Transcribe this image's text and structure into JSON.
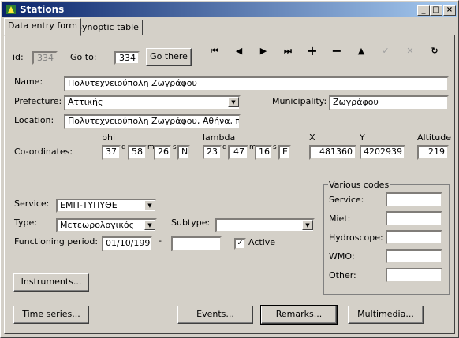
{
  "window": {
    "title": "Stations"
  },
  "tabs": [
    {
      "label": "Data entry form"
    },
    {
      "label": "Synoptic table"
    }
  ],
  "nav": {
    "id_label": "id:",
    "id_value": "334",
    "goto_label": "Go to:",
    "goto_value": "334",
    "goto_button": "Go there",
    "buttons": [
      "first",
      "previous",
      "next",
      "last",
      "add",
      "delete",
      "edit",
      "confirm",
      "cancel",
      "refresh"
    ]
  },
  "form": {
    "name_label": "Name:",
    "name_value": "Πολυτεχνειούπολη Ζωγράφου",
    "prefecture_label": "Prefecture:",
    "prefecture_value": "Αττικής",
    "municipality_label": "Municipality:",
    "municipality_value": "Ζωγράφου",
    "location_label": "Location:",
    "location_value": "Πολυτεχνειούπολη Ζωγράφου, Αθήνα, περίπ",
    "coords_label": "Co-ordinates:",
    "phi_label": "phi",
    "phi_d": "37",
    "phi_m": "58",
    "phi_s": "26",
    "phi_dir": "N",
    "lambda_label": "lambda",
    "lambda_d": "23",
    "lambda_m": "47",
    "lambda_s": "16",
    "lambda_dir": "E",
    "d_sym": "d",
    "m_sym": "m",
    "s_sym": "s",
    "x_label": "X",
    "x_value": "481360",
    "y_label": "Y",
    "y_value": "4202939",
    "alt_label": "Altitude",
    "alt_value": "219",
    "service_label": "Service:",
    "service_value": "ΕΜΠ-ΤΥΠΥΘΕ",
    "type_label": "Type:",
    "type_value": "Μετεωρολογικός",
    "subtype_label": "Subtype:",
    "subtype_value": "",
    "period_label": "Functioning period:",
    "period_start": "01/10/1993",
    "period_sep": "-",
    "period_end": "",
    "active_label": "Active",
    "active_checked": true
  },
  "codes": {
    "title": "Various codes",
    "service_label": "Service:",
    "miet_label": "Miet:",
    "hydroscope_label": "Hydroscope:",
    "wmo_label": "WMO:",
    "other_label": "Other:"
  },
  "buttons": {
    "instruments": "Instruments...",
    "time_series": "Time series...",
    "events": "Events...",
    "remarks": "Remarks...",
    "multimedia": "Multimedia..."
  }
}
